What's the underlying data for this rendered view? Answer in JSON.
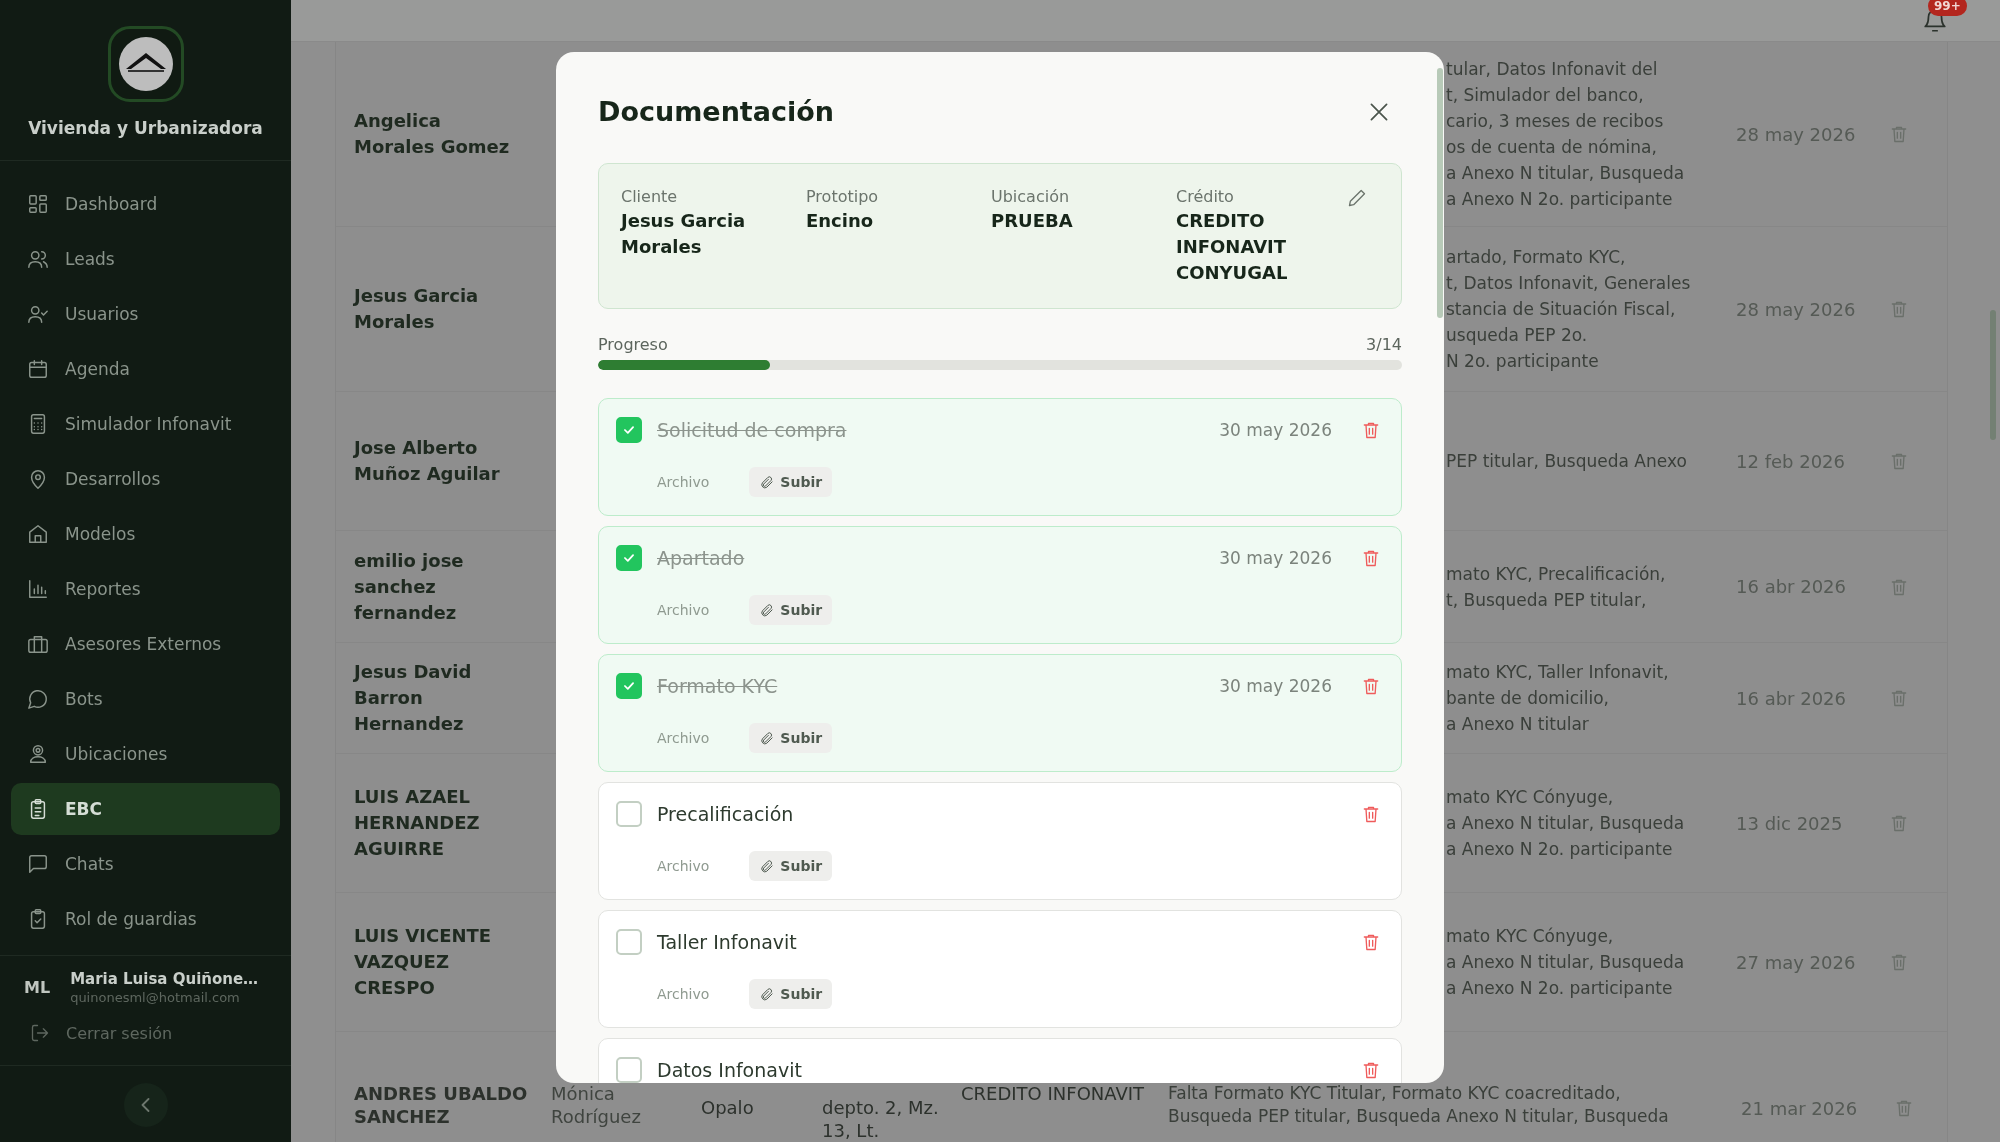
{
  "sidebar": {
    "brand": "Vivienda y Urbanizadora",
    "nav": [
      {
        "label": "Dashboard",
        "selected": false
      },
      {
        "label": "Leads",
        "selected": false
      },
      {
        "label": "Usuarios",
        "selected": false
      },
      {
        "label": "Agenda",
        "selected": false
      },
      {
        "label": "Simulador Infonavit",
        "selected": false
      },
      {
        "label": "Desarrollos",
        "selected": false
      },
      {
        "label": "Modelos",
        "selected": false
      },
      {
        "label": "Reportes",
        "selected": false
      },
      {
        "label": "Asesores Externos",
        "selected": false
      },
      {
        "label": "Bots",
        "selected": false
      },
      {
        "label": "Ubicaciones",
        "selected": false
      },
      {
        "label": "EBC",
        "selected": true
      },
      {
        "label": "Chats",
        "selected": false
      },
      {
        "label": "Rol de guardias",
        "selected": false
      }
    ],
    "user": {
      "initials": "ML",
      "name": "Maria Luisa Quiñone…",
      "email": "quinonesml@hotmail.com"
    },
    "logout": "Cerrar sesión"
  },
  "header": {
    "notification_badge": "99+"
  },
  "table": {
    "rows": [
      {
        "name": "Angelica Morales Gomez",
        "documents": [
          "tular, Datos Infonavit del",
          "t, Simulador del banco,",
          "cario, 3 meses de recibos",
          "os de cuenta de nómina,",
          "a Anexo N titular, Busqueda",
          "a Anexo N 2o. participante"
        ],
        "date": "28 may 2026"
      },
      {
        "name": "Jesus Garcia Morales",
        "documents": [
          "artado, Formato KYC,",
          "t, Datos Infonavit, Generales",
          "stancia de Situación Fiscal,",
          "usqueda PEP 2o.",
          "N 2o. participante"
        ],
        "date": "28 may 2026"
      },
      {
        "name": "Jose Alberto Muñoz Aguilar",
        "documents": [
          "PEP titular, Busqueda Anexo"
        ],
        "date": "12 feb 2026"
      },
      {
        "name": "emilio jose sanchez fernandez",
        "documents": [
          "mato KYC, Precalificación,",
          "t, Busqueda PEP titular,"
        ],
        "date": "16 abr 2026"
      },
      {
        "name": "Jesus David Barron Hernandez",
        "documents": [
          "mato KYC, Taller Infonavit,",
          "bante de domicilio,",
          "a Anexo N titular"
        ],
        "date": "16 abr 2026"
      },
      {
        "name": "LUIS AZAEL HERNANDEZ AGUIRRE",
        "documents": [
          "mato KYC Cónyuge,",
          "a Anexo N titular, Busqueda",
          "a Anexo N 2o. participante"
        ],
        "date": "13 dic 2025"
      },
      {
        "name": "LUIS VICENTE VAZQUEZ CRESPO",
        "documents": [
          "mato KYC Cónyuge,",
          "a Anexo N titular, Busqueda",
          "a Anexo N 2o. participante"
        ],
        "date": "27 may 2026"
      }
    ],
    "last_row": {
      "name": "ANDRES UBALDO SANCHEZ",
      "column_2": "Mónica Rodríguez",
      "column_3": "Opalo",
      "column_4": "depto. 2, Mz. 13, Lt.",
      "column_5": "CREDITO INFONAVIT",
      "documents": [
        "Falta Formato KYC Titular, Formato KYC coacreditado,",
        "Busqueda PEP titular, Busqueda Anexo N titular, Busqueda"
      ],
      "date": "21 mar 2026"
    }
  },
  "modal": {
    "title": "Documentación",
    "info": [
      {
        "label": "Cliente",
        "value": "Jesus Garcia Morales"
      },
      {
        "label": "Prototipo",
        "value": "Encino"
      },
      {
        "label": "Ubicación",
        "value": "PRUEBA"
      },
      {
        "label": "Crédito",
        "value": "CREDITO INFONAVIT CONYUGAL"
      }
    ],
    "progress": {
      "label": "Progreso",
      "count": "3/14",
      "level": 0.214
    },
    "documents": [
      {
        "title": "Solicitud de compra",
        "checked": true,
        "date": "30 may 2026",
        "file_label": "Archivo",
        "upload": "Subir"
      },
      {
        "title": "Apartado",
        "checked": true,
        "date": "30 may 2026",
        "file_label": "Archivo",
        "upload": "Subir"
      },
      {
        "title": "Formato KYC",
        "checked": true,
        "date": "30 may 2026",
        "file_label": "Archivo",
        "upload": "Subir"
      },
      {
        "title": "Precalificación",
        "checked": false,
        "file_label": "Archivo",
        "upload": "Subir"
      },
      {
        "title": "Taller Infonavit",
        "checked": false,
        "file_label": "Archivo",
        "upload": "Subir"
      },
      {
        "title": "Datos Infonavit",
        "checked": false
      }
    ]
  }
}
